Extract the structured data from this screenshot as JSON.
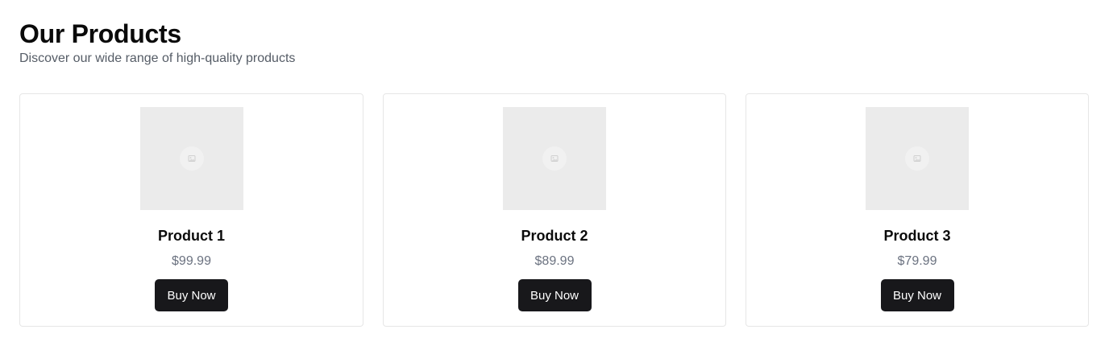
{
  "header": {
    "title": "Our Products",
    "subtitle": "Discover our wide range of high-quality products"
  },
  "products": [
    {
      "name": "Product 1",
      "price": "$99.99",
      "button_label": "Buy Now",
      "image_icon": "image-placeholder-icon"
    },
    {
      "name": "Product 2",
      "price": "$89.99",
      "button_label": "Buy Now",
      "image_icon": "image-placeholder-icon"
    },
    {
      "name": "Product 3",
      "price": "$79.99",
      "button_label": "Buy Now",
      "image_icon": "image-placeholder-icon"
    }
  ],
  "colors": {
    "button_bg": "#18181b",
    "button_text": "#ffffff",
    "card_border": "#e6e6e6",
    "placeholder_bg": "#ebebeb",
    "price_text": "#6b7280",
    "subtitle_text": "#555c66"
  }
}
